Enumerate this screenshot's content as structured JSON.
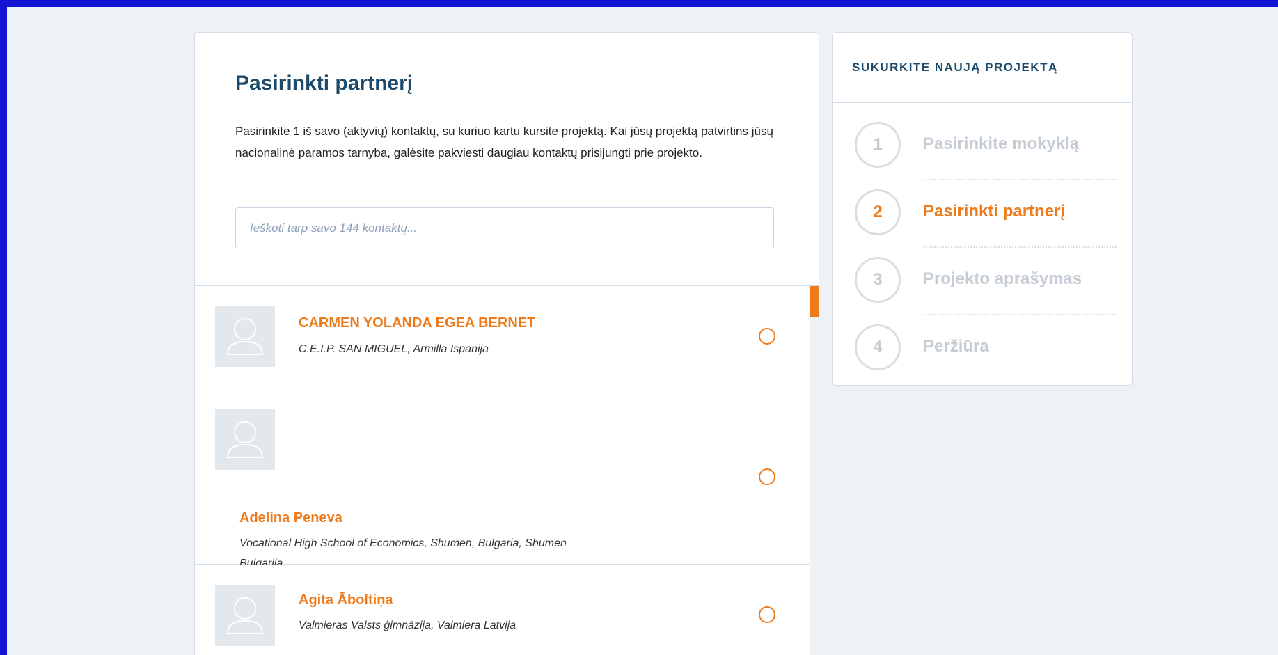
{
  "main": {
    "title": "Pasirinkti partnerį",
    "intro": "Pasirinkite 1 iš savo (aktyvių) kontaktų, su kuriuo kartu kursite projektą. Kai jūsų projektą patvirtins jūsų nacionalinė paramos tarnyba, galėsite pakviesti daugiau kontaktų prisijungti prie projekto.",
    "search_placeholder": "Ieškoti tarp savo 144 kontaktų...",
    "contacts": [
      {
        "name": "CARMEN YOLANDA EGEA BERNET",
        "school": "C.E.I.P. SAN MIGUEL, Armilla Ispanija"
      },
      {
        "name": "Adelina Peneva",
        "school": "Vocational High School of Economics, Shumen, Bulgaria, Shumen",
        "country": "Bulgarija"
      },
      {
        "name": "Agita Āboltiņa",
        "school": "Valmieras Valsts ģimnāzija, Valmiera Latvija"
      }
    ]
  },
  "sidebar": {
    "title": "SUKURKITE NAUJĄ PROJEKTĄ",
    "steps": [
      {
        "number": "1",
        "label": "Pasirinkite mokyklą",
        "active": false
      },
      {
        "number": "2",
        "label": "Pasirinkti partnerį",
        "active": true
      },
      {
        "number": "3",
        "label": "Projekto aprašymas",
        "active": false
      },
      {
        "number": "4",
        "label": "Peržiūra",
        "active": false
      }
    ]
  },
  "colors": {
    "accent": "#ee7a1a",
    "heading": "#1d4a6b",
    "frame": "#1414d4",
    "background": "#eef2f7",
    "inactive_step": "#c5ccd4"
  }
}
